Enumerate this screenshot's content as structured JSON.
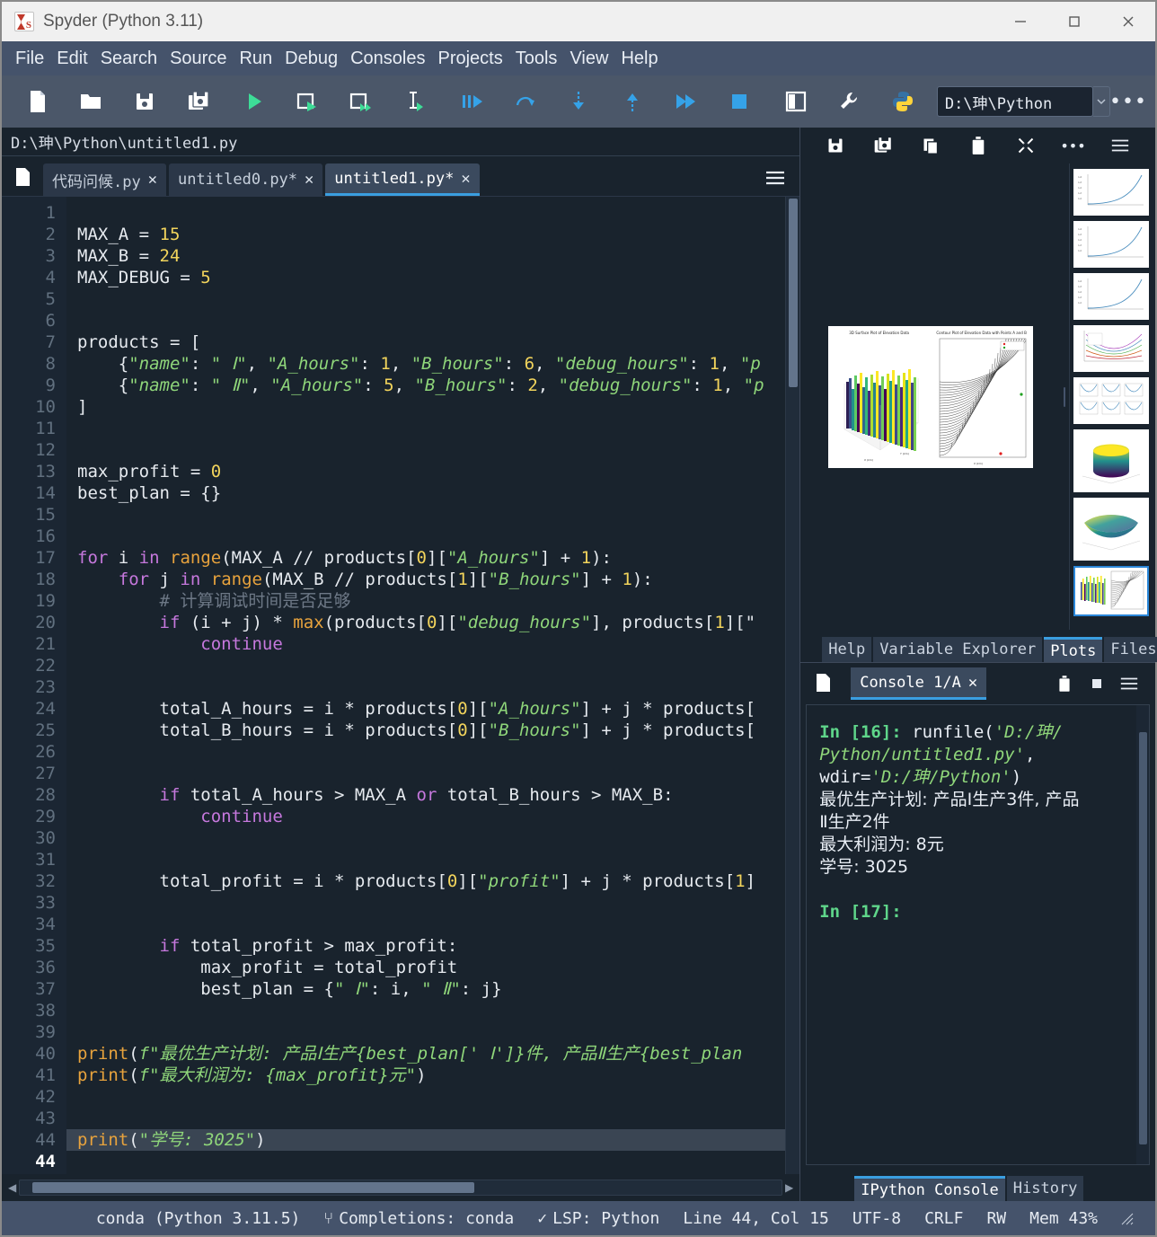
{
  "window": {
    "title": "Spyder (Python 3.11)",
    "app_icon": "spyder-icon",
    "minimize": "minimize-icon",
    "maximize": "maximize-icon",
    "close": "close-icon"
  },
  "menubar": {
    "items": [
      "File",
      "Edit",
      "Search",
      "Source",
      "Run",
      "Debug",
      "Consoles",
      "Projects",
      "Tools",
      "View",
      "Help"
    ]
  },
  "toolbar": {
    "buttons": [
      {
        "name": "new-file-icon",
        "title": "New file"
      },
      {
        "name": "open-file-icon",
        "title": "Open file"
      },
      {
        "name": "save-file-icon",
        "title": "Save file"
      },
      {
        "name": "save-all-icon",
        "title": "Save all"
      },
      {
        "name": "run-file-icon",
        "title": "Run file"
      },
      {
        "name": "run-cell-icon",
        "title": "Run cell"
      },
      {
        "name": "run-cell-advance-icon",
        "title": "Run cell and advance"
      },
      {
        "name": "run-selection-icon",
        "title": "Run selection"
      },
      {
        "name": "debug-file-icon",
        "title": "Debug file"
      },
      {
        "name": "step-over-icon",
        "title": "Step over"
      },
      {
        "name": "step-into-icon",
        "title": "Step into"
      },
      {
        "name": "step-return-icon",
        "title": "Step return"
      },
      {
        "name": "continue-icon",
        "title": "Continue"
      },
      {
        "name": "stop-debug-icon",
        "title": "Stop"
      },
      {
        "name": "pane-layout-icon",
        "title": "Maximize pane"
      },
      {
        "name": "preferences-icon",
        "title": "Preferences"
      },
      {
        "name": "python-path-icon",
        "title": "Python interpreter"
      }
    ],
    "path_value": "D:\\珅\\Python",
    "path_dropdown_icon": "chevron-down-icon",
    "overflow_icon": "toolbar-overflow-icon"
  },
  "editor": {
    "file_path": "D:\\珅\\Python\\untitled1.py",
    "browse_icon": "file-browser-icon",
    "options_icon": "hamburger-menu-icon",
    "tabs": [
      {
        "label": "代码问候.py",
        "active": false,
        "close_icon": "close-tab-icon"
      },
      {
        "label": "untitled0.py*",
        "active": false,
        "close_icon": "close-tab-icon"
      },
      {
        "label": "untitled1.py*",
        "active": true,
        "close_icon": "close-tab-icon"
      }
    ],
    "line_numbers": [
      "1",
      "2",
      "3",
      "4",
      "5",
      "6",
      "7",
      "8",
      "9",
      "10",
      "11",
      "12",
      "13",
      "14",
      "15",
      "16",
      "17",
      "18",
      "19",
      "20",
      "21",
      "22",
      "23",
      "24",
      "25",
      "26",
      "27",
      "28",
      "29",
      "30",
      "31",
      "32",
      "33",
      "34",
      "35",
      "36",
      "37",
      "38",
      "39",
      "40",
      "41",
      "42",
      "43",
      "44",
      "44"
    ],
    "current_line_index": 44,
    "lines": [
      [],
      [
        {
          "t": "MAX_A = ",
          "c": "plain"
        },
        {
          "t": "15",
          "c": "num"
        }
      ],
      [
        {
          "t": "MAX_B = ",
          "c": "plain"
        },
        {
          "t": "24",
          "c": "num"
        }
      ],
      [
        {
          "t": "MAX_DEBUG = ",
          "c": "plain"
        },
        {
          "t": "5",
          "c": "num"
        }
      ],
      [],
      [],
      [
        {
          "t": "products = [",
          "c": "plain"
        }
      ],
      [
        {
          "t": "    {",
          "c": "plain"
        },
        {
          "t": "\"name\"",
          "c": "str"
        },
        {
          "t": ": ",
          "c": "plain"
        },
        {
          "t": "\" Ⅰ\"",
          "c": "str"
        },
        {
          "t": ", ",
          "c": "plain"
        },
        {
          "t": "\"A_hours\"",
          "c": "str"
        },
        {
          "t": ": ",
          "c": "plain"
        },
        {
          "t": "1",
          "c": "num"
        },
        {
          "t": ", ",
          "c": "plain"
        },
        {
          "t": "\"B_hours\"",
          "c": "str"
        },
        {
          "t": ": ",
          "c": "plain"
        },
        {
          "t": "6",
          "c": "num"
        },
        {
          "t": ", ",
          "c": "plain"
        },
        {
          "t": "\"debug_hours\"",
          "c": "str"
        },
        {
          "t": ": ",
          "c": "plain"
        },
        {
          "t": "1",
          "c": "num"
        },
        {
          "t": ", ",
          "c": "plain"
        },
        {
          "t": "\"p",
          "c": "str"
        }
      ],
      [
        {
          "t": "    {",
          "c": "plain"
        },
        {
          "t": "\"name\"",
          "c": "str"
        },
        {
          "t": ": ",
          "c": "plain"
        },
        {
          "t": "\" Ⅱ\"",
          "c": "str"
        },
        {
          "t": ", ",
          "c": "plain"
        },
        {
          "t": "\"A_hours\"",
          "c": "str"
        },
        {
          "t": ": ",
          "c": "plain"
        },
        {
          "t": "5",
          "c": "num"
        },
        {
          "t": ", ",
          "c": "plain"
        },
        {
          "t": "\"B_hours\"",
          "c": "str"
        },
        {
          "t": ": ",
          "c": "plain"
        },
        {
          "t": "2",
          "c": "num"
        },
        {
          "t": ", ",
          "c": "plain"
        },
        {
          "t": "\"debug_hours\"",
          "c": "str"
        },
        {
          "t": ": ",
          "c": "plain"
        },
        {
          "t": "1",
          "c": "num"
        },
        {
          "t": ", ",
          "c": "plain"
        },
        {
          "t": "\"p",
          "c": "str"
        }
      ],
      [
        {
          "t": "]",
          "c": "plain"
        }
      ],
      [],
      [],
      [
        {
          "t": "max_profit = ",
          "c": "plain"
        },
        {
          "t": "0",
          "c": "num"
        }
      ],
      [
        {
          "t": "best_plan = {}",
          "c": "plain"
        }
      ],
      [],
      [],
      [
        {
          "t": "for",
          "c": "kw"
        },
        {
          "t": " i ",
          "c": "plain"
        },
        {
          "t": "in",
          "c": "kw"
        },
        {
          "t": " ",
          "c": "plain"
        },
        {
          "t": "range",
          "c": "bi"
        },
        {
          "t": "(MAX_A // products[",
          "c": "plain"
        },
        {
          "t": "0",
          "c": "num"
        },
        {
          "t": "][",
          "c": "plain"
        },
        {
          "t": "\"A_hours\"",
          "c": "str"
        },
        {
          "t": "] + ",
          "c": "plain"
        },
        {
          "t": "1",
          "c": "num"
        },
        {
          "t": "):",
          "c": "plain"
        }
      ],
      [
        {
          "t": "    ",
          "c": "plain"
        },
        {
          "t": "for",
          "c": "kw"
        },
        {
          "t": " j ",
          "c": "plain"
        },
        {
          "t": "in",
          "c": "kw"
        },
        {
          "t": " ",
          "c": "plain"
        },
        {
          "t": "range",
          "c": "bi"
        },
        {
          "t": "(MAX_B // products[",
          "c": "plain"
        },
        {
          "t": "1",
          "c": "num"
        },
        {
          "t": "][",
          "c": "plain"
        },
        {
          "t": "\"B_hours\"",
          "c": "str"
        },
        {
          "t": "] + ",
          "c": "plain"
        },
        {
          "t": "1",
          "c": "num"
        },
        {
          "t": "):",
          "c": "plain"
        }
      ],
      [
        {
          "t": "        # 计算调试时间是否足够",
          "c": "cmt"
        }
      ],
      [
        {
          "t": "        ",
          "c": "plain"
        },
        {
          "t": "if",
          "c": "kw"
        },
        {
          "t": " (i + j) * ",
          "c": "plain"
        },
        {
          "t": "max",
          "c": "bi"
        },
        {
          "t": "(products[",
          "c": "plain"
        },
        {
          "t": "0",
          "c": "num"
        },
        {
          "t": "][",
          "c": "plain"
        },
        {
          "t": "\"debug_hours\"",
          "c": "str"
        },
        {
          "t": "], products[",
          "c": "plain"
        },
        {
          "t": "1",
          "c": "num"
        },
        {
          "t": "][\"",
          "c": "plain"
        }
      ],
      [
        {
          "t": "            ",
          "c": "plain"
        },
        {
          "t": "continue",
          "c": "kw"
        }
      ],
      [],
      [],
      [
        {
          "t": "        total_A_hours = i * products[",
          "c": "plain"
        },
        {
          "t": "0",
          "c": "num"
        },
        {
          "t": "][",
          "c": "plain"
        },
        {
          "t": "\"A_hours\"",
          "c": "str"
        },
        {
          "t": "] + j * products[",
          "c": "plain"
        }
      ],
      [
        {
          "t": "        total_B_hours = i * products[",
          "c": "plain"
        },
        {
          "t": "0",
          "c": "num"
        },
        {
          "t": "][",
          "c": "plain"
        },
        {
          "t": "\"B_hours\"",
          "c": "str"
        },
        {
          "t": "] + j * products[",
          "c": "plain"
        }
      ],
      [],
      [],
      [
        {
          "t": "        ",
          "c": "plain"
        },
        {
          "t": "if",
          "c": "kw"
        },
        {
          "t": " total_A_hours > MAX_A ",
          "c": "plain"
        },
        {
          "t": "or",
          "c": "kw"
        },
        {
          "t": " total_B_hours > MAX_B:",
          "c": "plain"
        }
      ],
      [
        {
          "t": "            ",
          "c": "plain"
        },
        {
          "t": "continue",
          "c": "kw"
        }
      ],
      [],
      [],
      [
        {
          "t": "        total_profit = i * products[",
          "c": "plain"
        },
        {
          "t": "0",
          "c": "num"
        },
        {
          "t": "][",
          "c": "plain"
        },
        {
          "t": "\"profit\"",
          "c": "str"
        },
        {
          "t": "] + j * products[",
          "c": "plain"
        },
        {
          "t": "1",
          "c": "num"
        },
        {
          "t": "]",
          "c": "plain"
        }
      ],
      [],
      [],
      [
        {
          "t": "        ",
          "c": "plain"
        },
        {
          "t": "if",
          "c": "kw"
        },
        {
          "t": " total_profit > max_profit:",
          "c": "plain"
        }
      ],
      [
        {
          "t": "            max_profit = total_profit",
          "c": "plain"
        }
      ],
      [
        {
          "t": "            best_plan = {",
          "c": "plain"
        },
        {
          "t": "\" Ⅰ\"",
          "c": "str"
        },
        {
          "t": ": i, ",
          "c": "plain"
        },
        {
          "t": "\" Ⅱ\"",
          "c": "str"
        },
        {
          "t": ": j}",
          "c": "plain"
        }
      ],
      [],
      [],
      [
        {
          "t": "print",
          "c": "bi"
        },
        {
          "t": "(",
          "c": "plain"
        },
        {
          "t": "f\"最优生产计划: 产品Ⅰ生产{best_plan[' Ⅰ']}件, 产品Ⅱ生产{best_plan",
          "c": "str"
        }
      ],
      [
        {
          "t": "print",
          "c": "bi"
        },
        {
          "t": "(",
          "c": "plain"
        },
        {
          "t": "f\"最大利润为: {max_profit}元\"",
          "c": "str"
        },
        {
          "t": ")",
          "c": "plain"
        }
      ],
      [],
      [],
      [
        {
          "t": "print",
          "c": "bi"
        },
        {
          "t": "(",
          "c": "plain"
        },
        {
          "t": "\"学号: 3025\"",
          "c": "str"
        },
        {
          "t": ")",
          "c": "plain"
        }
      ]
    ],
    "hscroll_left_arrow": "scroll-left-icon",
    "hscroll_right_arrow": "scroll-right-icon"
  },
  "plots": {
    "toolbar_buttons": [
      {
        "name": "save-plot-icon"
      },
      {
        "name": "save-all-plots-icon"
      },
      {
        "name": "copy-plot-icon"
      },
      {
        "name": "remove-plot-icon"
      },
      {
        "name": "remove-all-plots-icon"
      },
      {
        "name": "plot-options-more-icon"
      },
      {
        "name": "hamburger-menu-icon"
      }
    ],
    "figure_titles": [
      "3D Surface Plot of Elevation Data",
      "Contour Plot of Elevation Data with Points A and B"
    ],
    "thumbnails": [
      {
        "name": "thumbnail-exponential-1",
        "selected": false
      },
      {
        "name": "thumbnail-exponential-2",
        "selected": false
      },
      {
        "name": "thumbnail-exponential-3",
        "selected": false
      },
      {
        "name": "thumbnail-parabola-family",
        "selected": false
      },
      {
        "name": "thumbnail-subplot-grid",
        "selected": false
      },
      {
        "name": "thumbnail-3d-surface-cylinder",
        "selected": false
      },
      {
        "name": "thumbnail-3d-surface-saddle",
        "selected": false
      },
      {
        "name": "thumbnail-elevation-pair",
        "selected": true
      }
    ],
    "tabs": [
      {
        "label": "Help",
        "active": false
      },
      {
        "label": "Variable Explorer",
        "active": false
      },
      {
        "label": "Plots",
        "active": true
      },
      {
        "label": "Files",
        "active": false
      }
    ]
  },
  "console": {
    "browse_icon": "file-browser-icon",
    "tab_label": "Console 1/A",
    "tab_close_icon": "close-tab-icon",
    "tools": [
      {
        "name": "remove-console-icon"
      },
      {
        "name": "stop-console-icon"
      },
      {
        "name": "hamburger-menu-icon"
      }
    ],
    "output": [
      {
        "type": "prompt",
        "text": "In [16]:"
      },
      {
        "type": "plain",
        "text": " runfile("
      },
      {
        "type": "str",
        "text": "'D:/珅/Python/untitled1.py'"
      },
      {
        "type": "plain",
        "text": ",\nwdir="
      },
      {
        "type": "str",
        "text": "'D:/珅/Python'"
      },
      {
        "type": "plain",
        "text": ")"
      },
      {
        "type": "cjk",
        "text": "\n最优生产计划: 产品Ⅰ生产3件, 产品Ⅱ生产2件\n最大利润为: 8元\n学号: 3025\n\n"
      },
      {
        "type": "prompt",
        "text": "In [17]:"
      }
    ],
    "lines_display": {
      "l1_prompt": "In [16]:",
      "l1_rest": " runfile(",
      "l1_str_a": "'D:/珅/",
      "l2_str": "Python/untitled1.py'",
      "l2_comma": ",",
      "l3_pre": "wdir=",
      "l3_str": "'D:/珅/Python'",
      "l3_post": ")",
      "l4": "最优生产计划: 产品Ⅰ生产3件, 产品",
      "l5": "Ⅱ生产2件",
      "l6": "最大利润为: 8元",
      "l7": "学号: 3025",
      "l8_prompt": "In [17]:"
    },
    "tabs": [
      {
        "label": "IPython Console",
        "active": true
      },
      {
        "label": "History",
        "active": false
      }
    ]
  },
  "statusbar": {
    "interpreter": "conda (Python 3.11.5)",
    "branch_icon": "git-branch-icon",
    "completions": "Completions: conda",
    "check_icon": "check-icon",
    "lsp": "LSP: Python",
    "position": "Line 44, Col 15",
    "encoding": "UTF-8",
    "eol": "CRLF",
    "permissions": "RW",
    "memory": "Mem 43%",
    "resize_grip": "resize-grip-icon"
  },
  "colors": {
    "accent": "#3a9ee0",
    "editor_bg": "#19232d",
    "toolbar_bg": "#4b5769",
    "menubar_bg": "#45536b",
    "string": "#8fd67a",
    "number": "#f2d45c",
    "keyword": "#c678dd",
    "builtin": "#e8a33d",
    "prompt_green": "#5fd68a"
  }
}
